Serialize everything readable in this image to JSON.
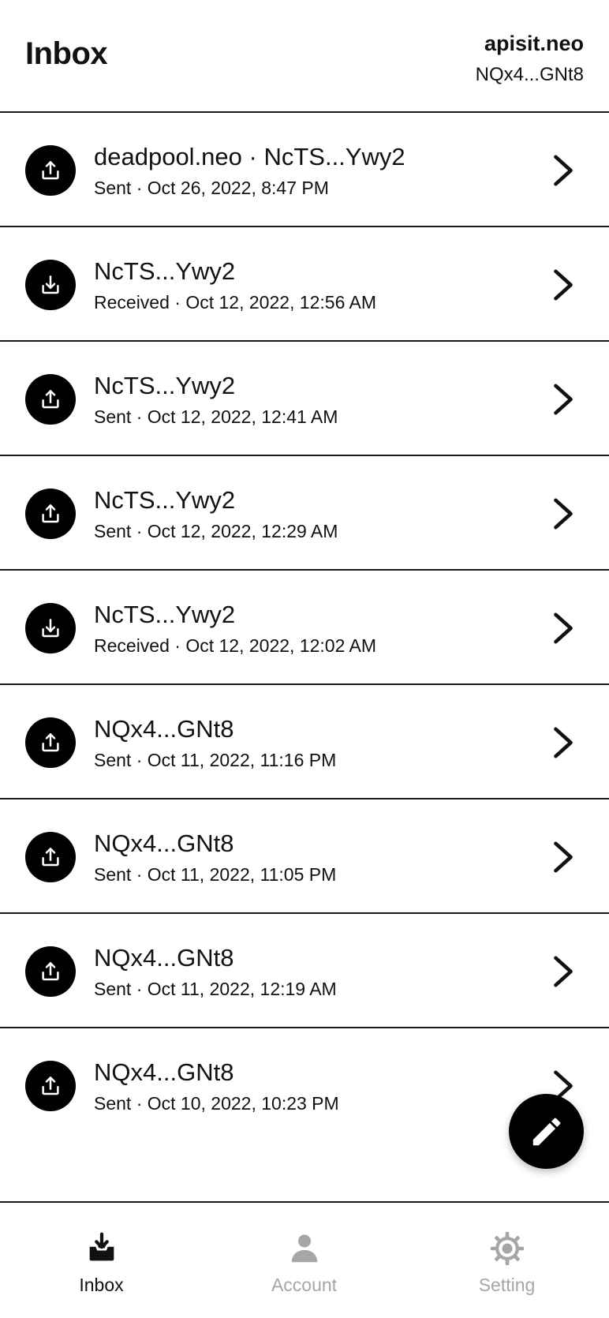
{
  "header": {
    "title": "Inbox",
    "account_name": "apisit.neo",
    "account_address": "NQx4...GNt8"
  },
  "messages": [
    {
      "title": "deadpool.neo · NcTS...Ywy2",
      "subtitle": "Sent · Oct 26, 2022, 8:47 PM",
      "direction": "sent"
    },
    {
      "title": "NcTS...Ywy2",
      "subtitle": "Received · Oct 12, 2022, 12:56 AM",
      "direction": "received"
    },
    {
      "title": "NcTS...Ywy2",
      "subtitle": "Sent · Oct 12, 2022, 12:41 AM",
      "direction": "sent"
    },
    {
      "title": "NcTS...Ywy2",
      "subtitle": "Sent · Oct 12, 2022, 12:29 AM",
      "direction": "sent"
    },
    {
      "title": "NcTS...Ywy2",
      "subtitle": "Received · Oct 12, 2022, 12:02 AM",
      "direction": "received"
    },
    {
      "title": "NQx4...GNt8",
      "subtitle": "Sent · Oct 11, 2022, 11:16 PM",
      "direction": "sent"
    },
    {
      "title": "NQx4...GNt8",
      "subtitle": "Sent · Oct 11, 2022, 11:05 PM",
      "direction": "sent"
    },
    {
      "title": "NQx4...GNt8",
      "subtitle": "Sent · Oct 11, 2022, 12:19 AM",
      "direction": "sent"
    },
    {
      "title": "NQx4...GNt8",
      "subtitle": "Sent · Oct 10, 2022, 10:23 PM",
      "direction": "sent"
    }
  ],
  "fab": {
    "icon": "pencil-icon"
  },
  "tabs": [
    {
      "label": "Inbox",
      "icon": "inbox-icon",
      "active": true
    },
    {
      "label": "Account",
      "icon": "person-icon",
      "active": false
    },
    {
      "label": "Setting",
      "icon": "gear-icon",
      "active": false
    }
  ],
  "colors": {
    "primary": "#000000",
    "inactive": "#a6a6a6",
    "divider": "#1a1a1a"
  }
}
